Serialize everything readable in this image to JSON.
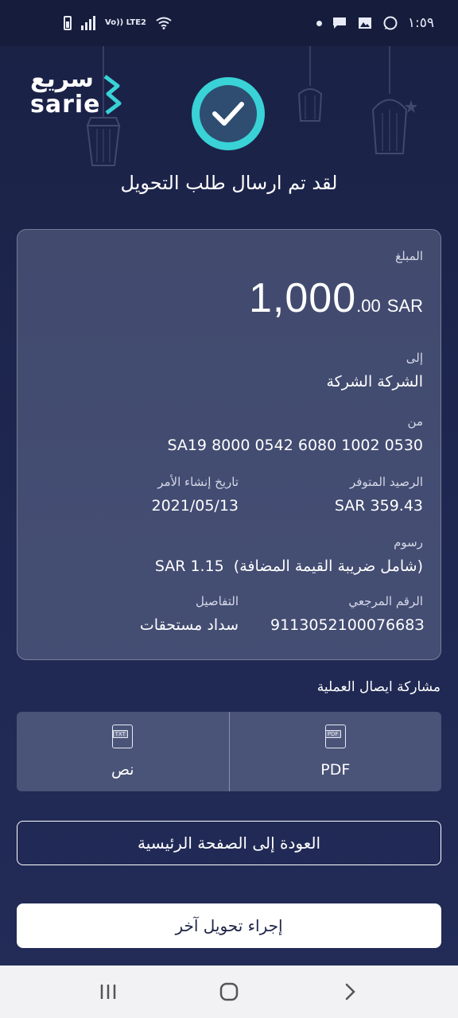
{
  "status_bar": {
    "time": "١:٥٩",
    "volte": "Vo)) LTE2",
    "icons": [
      "battery-icon",
      "signal-icon",
      "volte-icon",
      "wifi-icon",
      "dot-icon",
      "message-icon",
      "gallery-icon",
      "whatsapp-icon"
    ]
  },
  "brand": {
    "name_ar": "سريع",
    "name_en": "sarie",
    "accent": "#39d2d6"
  },
  "headline": "لقد تم ارسال طلب التحويل",
  "details": {
    "amount_label": "المبلغ",
    "amount_whole": "1,000",
    "amount_decimal": ".00",
    "amount_currency": "SAR",
    "to_label": "إلى",
    "to_value": "الشركة الشركة",
    "from_label": "من",
    "from_value": "SA19 8000 0542 6080 1002 0530",
    "balance_label": "الرصيد المتوفر",
    "balance_value": "SAR 359.43",
    "date_label": "تاريخ إنشاء الأمر",
    "date_value": "2021/05/13",
    "fees_label": "رسوم",
    "fees_note": "(شامل ضريبة القيمة المضافة)",
    "fees_value": "SAR  1.15",
    "ref_label": "الرقم المرجعي",
    "ref_value": "911305210007668З",
    "details_label": "التفاصيل",
    "details_value": "سداد مستحقات"
  },
  "share": {
    "title": "مشاركة ايصال العملية",
    "pdf_icon_text": "PDF",
    "pdf_label": "PDF",
    "txt_icon_text": "TXT",
    "txt_label": "نص"
  },
  "actions": {
    "home_label": "العودة إلى الصفحة الرئيسية",
    "another_label": "إجراء تحويل آخر"
  },
  "nav": [
    "recents-icon",
    "home-icon",
    "back-icon"
  ]
}
